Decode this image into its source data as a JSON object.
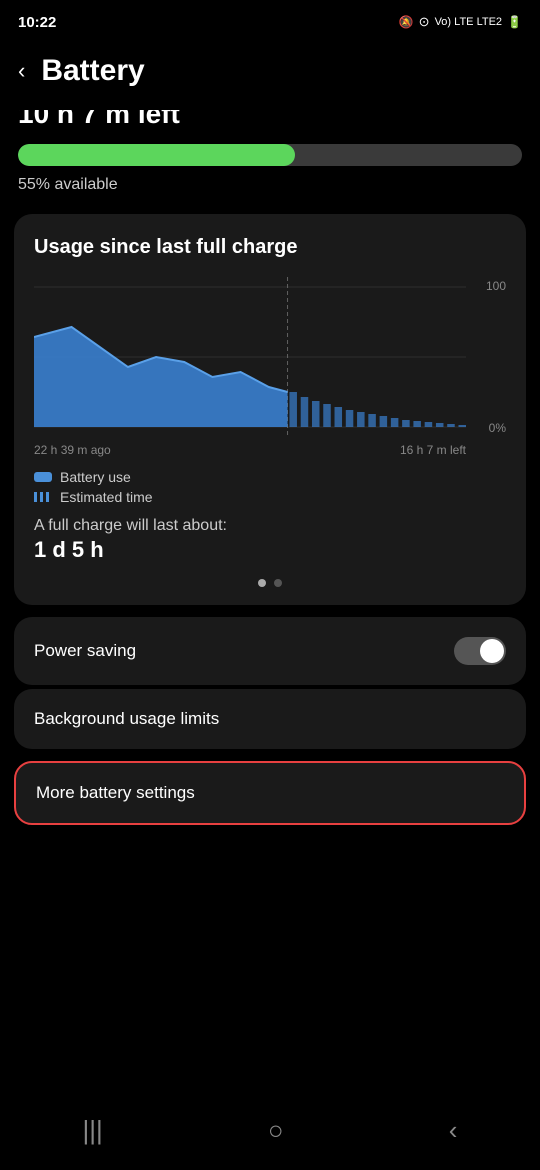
{
  "statusBar": {
    "time": "10:22",
    "icons": "🔕 📶 LTE2 🔋"
  },
  "header": {
    "backLabel": "‹",
    "title": "Battery"
  },
  "battery": {
    "timeRemaining": "10 h 7 m left",
    "timeRemainingPartial": "10 h 7 m left",
    "fillPercent": 55,
    "availableLabel": "55% available"
  },
  "usageCard": {
    "title": "Usage since last full charge",
    "chartXLeft": "22 h 39 m ago",
    "chartXRight": "16 h 7 m left",
    "chartY100": "100",
    "chartY0": "0%",
    "legendBatteryUse": "Battery use",
    "legendEstimatedTime": "Estimated time",
    "fullChargeLabel": "A full charge will last about:",
    "fullChargeValue": "1 d 5 h"
  },
  "settings": {
    "powerSavingLabel": "Power saving",
    "backgroundUsageLabel": "Background usage limits",
    "moreSettingsLabel": "More battery settings"
  },
  "bottomNav": {
    "recentIcon": "|||",
    "homeIcon": "○",
    "backIcon": "‹"
  }
}
